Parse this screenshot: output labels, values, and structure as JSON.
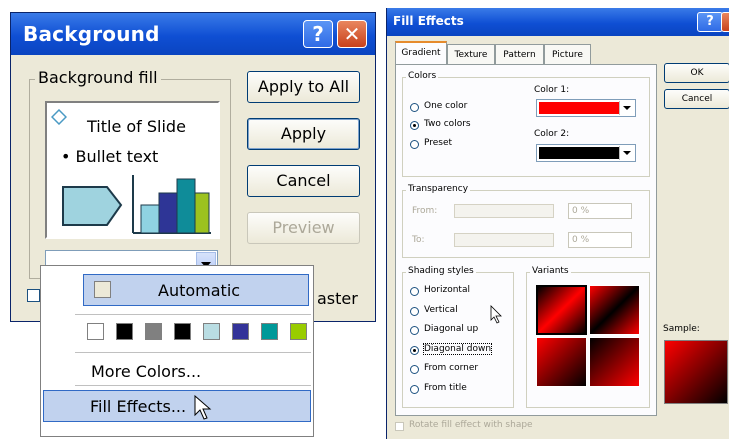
{
  "background_dialog": {
    "title": "Background",
    "help_glyph": "?",
    "close_glyph": "✕",
    "fill_group_label": "Background fill",
    "preview": {
      "title": "Title of Slide",
      "bullet": "• Bullet text"
    },
    "buttons": {
      "apply_all": "Apply to All",
      "apply": "Apply",
      "cancel": "Cancel",
      "preview": "Preview"
    },
    "omit_master_partial": "aster"
  },
  "color_dropdown": {
    "automatic_label": "Automatic",
    "swatches": [
      "#ffffff",
      "#000000",
      "#808080",
      "#000000",
      "#b9dde3",
      "#333399",
      "#009999",
      "#99cc00"
    ],
    "more_colors": "More Colors...",
    "fill_effects": "Fill Effects..."
  },
  "fill_effects_dialog": {
    "title": "Fill Effects",
    "help_glyph": "?",
    "close_glyph": "✕",
    "tabs": [
      "Gradient",
      "Texture",
      "Pattern",
      "Picture"
    ],
    "colors_group": "Colors",
    "color_options": [
      "One color",
      "Two colors",
      "Preset"
    ],
    "color1_label": "Color 1:",
    "color2_label": "Color 2:",
    "color1": "#ff0000",
    "color2": "#000000",
    "transparency_group": "Transparency",
    "from_label": "From:",
    "to_label": "To:",
    "from_value": "0 %",
    "to_value": "0 %",
    "shading_group": "Shading styles",
    "shading_options": [
      "Horizontal",
      "Vertical",
      "Diagonal up",
      "Diagonal down",
      "From corner",
      "From title"
    ],
    "variants_label": "Variants",
    "ok": "OK",
    "cancel": "Cancel",
    "sample_label": "Sample:",
    "rotate_label": "Rotate fill effect with shape"
  }
}
